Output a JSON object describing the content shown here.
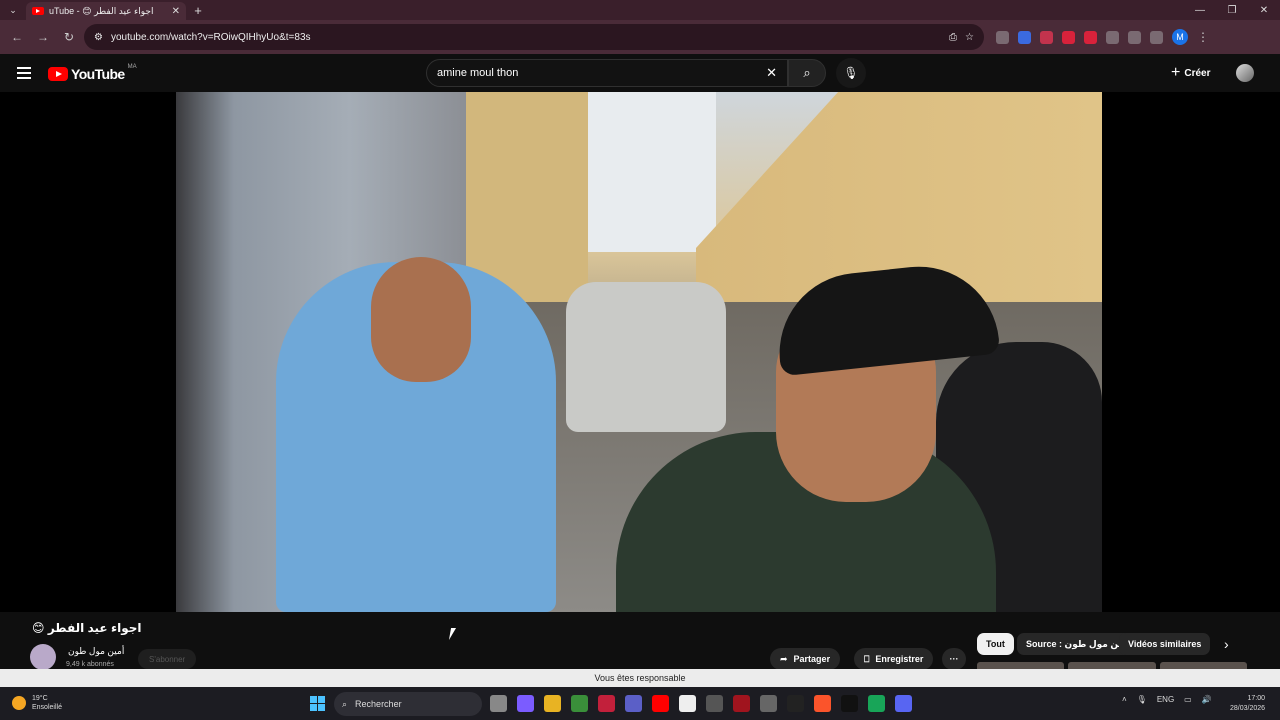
{
  "browser": {
    "tab_title": "‎uTube - 😊 اجواء عيد الفطر",
    "url": "youtube.com/watch?v=ROiwQIHhyUo&t=83s",
    "profile_initial": "M"
  },
  "youtube": {
    "logo_text": "YouTube",
    "country": "MA",
    "search_query": "amine moul thon",
    "create_label": "Créer"
  },
  "video": {
    "title": "اجواء عيد الفطر 😊",
    "channel_name": "أمين مول طون",
    "subscribers": "9,49 k abonnés",
    "subscribe_label": "S'abonner",
    "share_label": "Partager",
    "save_label": "Enregistrer",
    "chips": [
      "Tout",
      "Source : أمين مول طون",
      "Vidéos similaires"
    ]
  },
  "banner_text": "Vous êtes responsable",
  "taskbar": {
    "temperature": "19°C",
    "weather": "Ensoleillé",
    "search_placeholder": "Rechercher",
    "language": "ENG",
    "time": "17:00",
    "date": "28/03/2026"
  },
  "colors": {
    "youtube_red": "#ff0000",
    "browser_frame": "#4a2b38",
    "windows_blue": "#4cc2ff"
  }
}
